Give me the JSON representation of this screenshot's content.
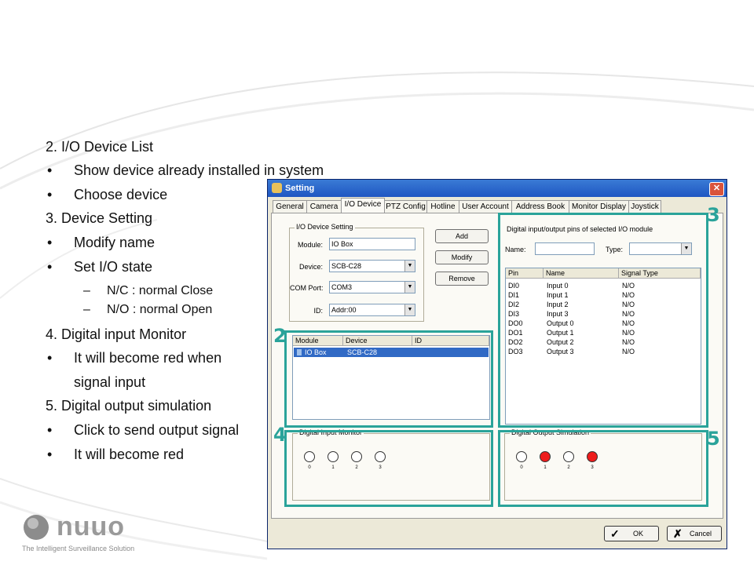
{
  "slide": {
    "lines": [
      {
        "text": "2. I/O Device List",
        "level": 0
      },
      {
        "text": "Show device already installed in system",
        "level": 1
      },
      {
        "text": "Choose device",
        "level": 1
      },
      {
        "text": "3. Device Setting",
        "level": 0
      },
      {
        "text": "Modify name",
        "level": 1
      },
      {
        "text": "Set I/O state",
        "level": 1
      },
      {
        "text": "N/C : normal Close",
        "level": 2
      },
      {
        "text": "N/O : normal Open",
        "level": 2
      },
      {
        "text": "4. Digital input Monitor",
        "level": 0
      },
      {
        "text": "It will become red when",
        "level": 1
      },
      {
        "text": "signal input",
        "level": 3
      },
      {
        "text": "5. Digital output simulation",
        "level": 0
      },
      {
        "text": "Click to send output signal",
        "level": 1
      },
      {
        "text": "It will become red",
        "level": 1
      }
    ],
    "bullet": "•",
    "dash": "–"
  },
  "logo": {
    "brand": "nuuo",
    "tagline": "The Intelligent Surveillance Solution"
  },
  "dialog": {
    "title": "Setting",
    "close_label": "✕",
    "tabs": [
      "General",
      "Camera",
      "I/O Device",
      "PTZ Config",
      "Hotline",
      "User Account",
      "Address Book",
      "Monitor Display",
      "Joystick"
    ],
    "active_tab": 2,
    "io_setting": {
      "group_label": "I/O Device Setting",
      "module_label": "Module:",
      "module_value": "IO Box",
      "device_label": "Device:",
      "device_value": "SCB-C28",
      "com_label": "COM Port:",
      "com_value": "COM3",
      "id_label": "ID:",
      "id_value": "Addr:00"
    },
    "buttons": {
      "add": "Add",
      "modify": "Modify",
      "remove": "Remove"
    },
    "device_list": {
      "columns": [
        "Module",
        "Device",
        "ID"
      ],
      "rows": [
        {
          "module": "IO Box",
          "device": "SCB-C28",
          "id": ""
        }
      ]
    },
    "pins": {
      "group_label": "Digital input/output pins of selected I/O module",
      "name_label": "Name:",
      "type_label": "Type:",
      "columns": [
        "Pin",
        "Name",
        "Signal Type"
      ],
      "rows": [
        {
          "pin": "DI0",
          "name": "Input 0",
          "type": "N/O"
        },
        {
          "pin": "DI1",
          "name": "Input 1",
          "type": "N/O"
        },
        {
          "pin": "DI2",
          "name": "Input 2",
          "type": "N/O"
        },
        {
          "pin": "DI3",
          "name": "Input 3",
          "type": "N/O"
        },
        {
          "pin": "DO0",
          "name": "Output 0",
          "type": "N/O"
        },
        {
          "pin": "DO1",
          "name": "Output 1",
          "type": "N/O"
        },
        {
          "pin": "DO2",
          "name": "Output 2",
          "type": "N/O"
        },
        {
          "pin": "DO3",
          "name": "Output 3",
          "type": "N/O"
        }
      ]
    },
    "input_monitor": {
      "label": "Digital Input Monitor",
      "channels": [
        {
          "n": "0",
          "on": false
        },
        {
          "n": "1",
          "on": false
        },
        {
          "n": "2",
          "on": false
        },
        {
          "n": "3",
          "on": false
        }
      ]
    },
    "output_sim": {
      "label": "Digital Output Simulation",
      "channels": [
        {
          "n": "0",
          "on": false
        },
        {
          "n": "1",
          "on": true
        },
        {
          "n": "2",
          "on": false
        },
        {
          "n": "3",
          "on": true
        }
      ]
    },
    "ok_label": "OK",
    "cancel_label": "Cancel"
  },
  "callouts": [
    "2",
    "3",
    "4",
    "5"
  ],
  "colors": {
    "teal": "#2aa39a",
    "active": "#ee1c1c",
    "selection": "#316ac5",
    "titlebar": "#1f56c2"
  }
}
